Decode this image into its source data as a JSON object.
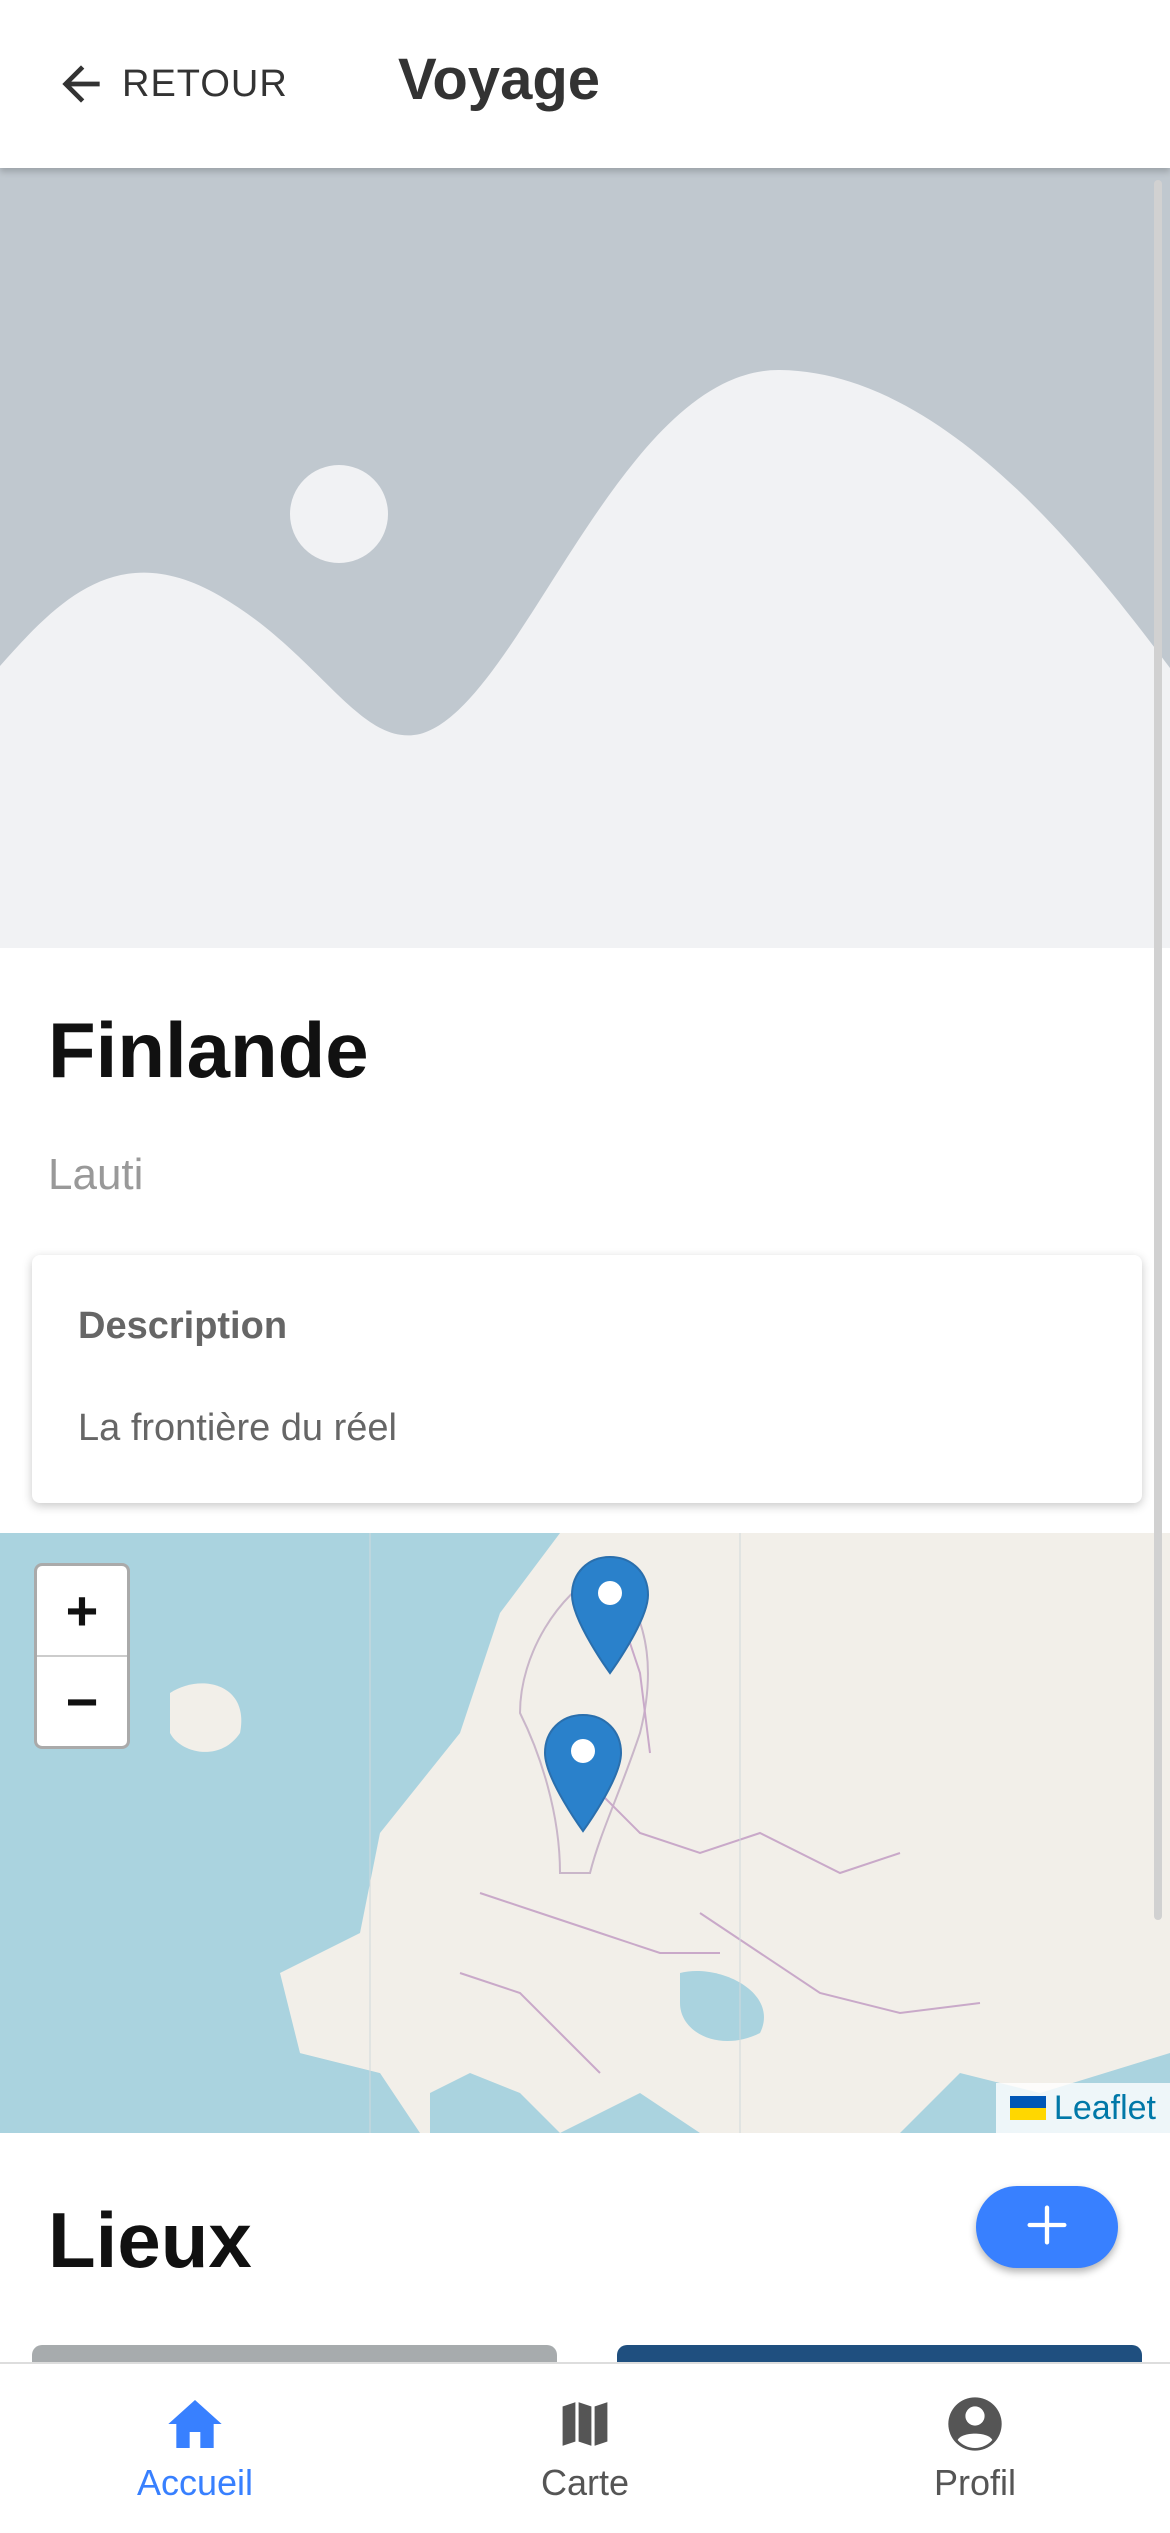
{
  "header": {
    "back_label": "RETOUR",
    "title": "Voyage"
  },
  "trip": {
    "name": "Finlande",
    "owner": "Lauti"
  },
  "description": {
    "title": "Description",
    "text": "La frontière du réel"
  },
  "map": {
    "zoom_in": "+",
    "zoom_out": "−",
    "attribution": "Leaflet",
    "marker_count": 2
  },
  "places": {
    "title": "Lieux"
  },
  "tabs": [
    {
      "label": "Accueil",
      "icon": "home-icon",
      "active": true
    },
    {
      "label": "Carte",
      "icon": "map-icon",
      "active": false
    },
    {
      "label": "Profil",
      "icon": "person-circle-icon",
      "active": false
    }
  ],
  "colors": {
    "accent": "#3880ff",
    "marker": "#2a81cb",
    "inactive": "#555555",
    "placeholder_bg": "#c0c8cf",
    "placeholder_fg": "#f1f2f4"
  }
}
